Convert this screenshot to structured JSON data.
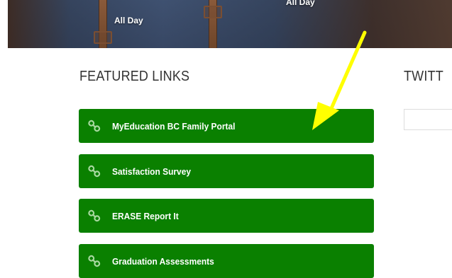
{
  "hero": {
    "events": [
      {
        "time": "All Day"
      },
      {
        "time": "All Day"
      }
    ]
  },
  "featured_links": {
    "title": "FEATURED LINKS",
    "items": [
      {
        "label": "MyEducation BC Family Portal",
        "icon": "link-icon"
      },
      {
        "label": "Satisfaction Survey",
        "icon": "link-icon"
      },
      {
        "label": "ERASE Report It",
        "icon": "link-icon"
      },
      {
        "label": "Graduation Assessments",
        "icon": "link-icon"
      }
    ]
  },
  "twitter": {
    "title": "TWITT"
  },
  "colors": {
    "link_button": "#0a8000",
    "arrow": "#ffff00",
    "heading": "#333333"
  }
}
